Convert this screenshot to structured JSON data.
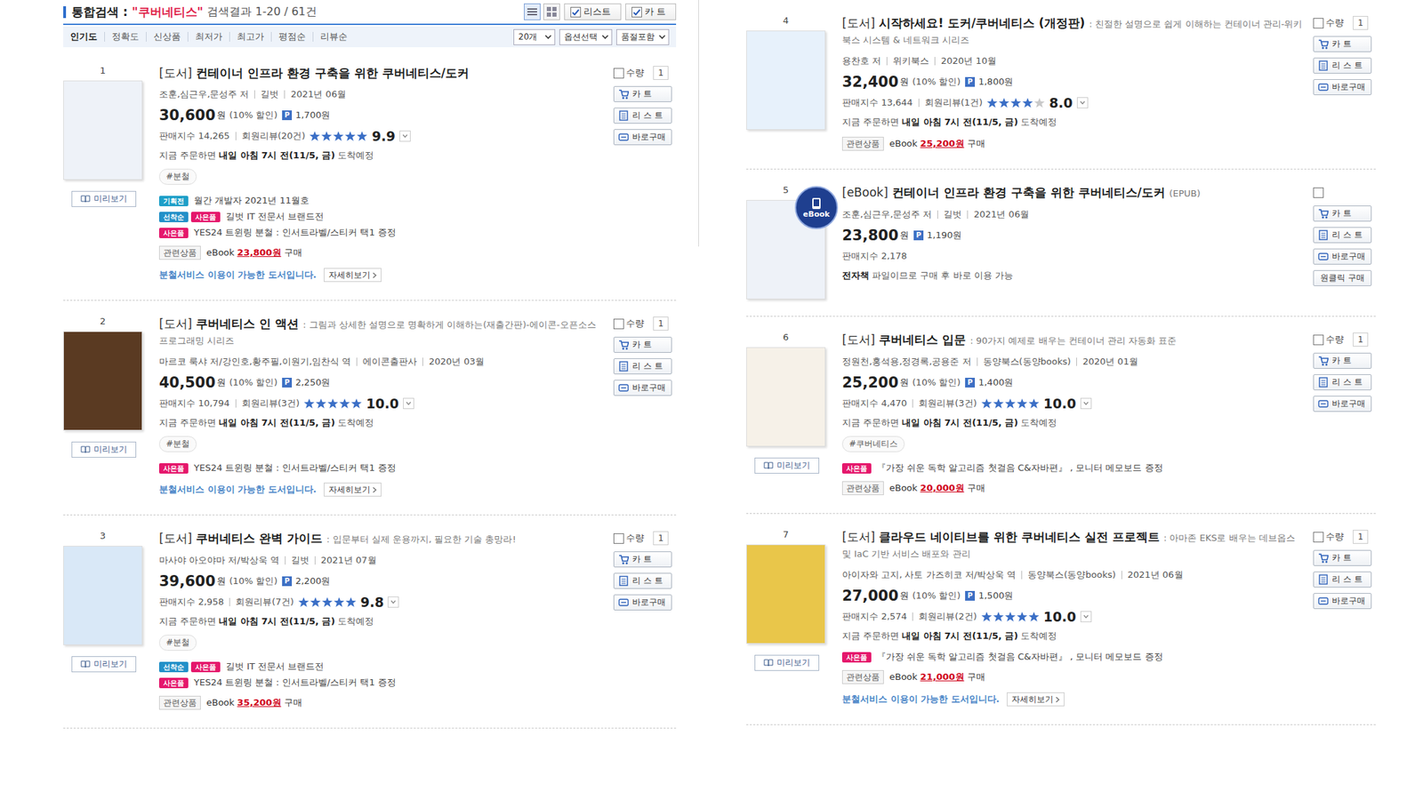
{
  "header": {
    "label": "통합검색 :",
    "query": "\"쿠버네티스\"",
    "result": "검색결과 1-20 / 61건"
  },
  "view_modes": [
    {
      "selected": true
    },
    {
      "selected": false
    }
  ],
  "view_actions": [
    {
      "label": "리스트",
      "checked": true
    },
    {
      "label": "카 트",
      "checked": true
    }
  ],
  "sort_tabs": [
    {
      "label": "인기도",
      "selected": true
    },
    {
      "label": "정확도",
      "selected": false
    },
    {
      "label": "신상품",
      "selected": false
    },
    {
      "label": "최저가",
      "selected": false
    },
    {
      "label": "최고가",
      "selected": false
    },
    {
      "label": "평점순",
      "selected": false
    },
    {
      "label": "리뷰순",
      "selected": false
    }
  ],
  "dropdowns": [
    "20개",
    "옵션선택",
    "품절포함"
  ],
  "items": [
    {
      "rank": "1",
      "column": "left",
      "checked": false,
      "qty_label": "수량",
      "qty": "1",
      "buttons": [
        {
          "label": "카 트",
          "kind": "cart"
        },
        {
          "label": "리 스 트",
          "kind": "list"
        },
        {
          "label": "바로구매",
          "kind": "buy"
        }
      ],
      "cover": "#eef2f8",
      "preview": "미리보기",
      "cat": "[도서]",
      "title": "컨테이너 인프라 환경 구축을 위한 쿠버네티스/도커",
      "authors": "조훈,심근우,문성주 저",
      "publisher": "길벗",
      "date": "2021년 06월",
      "price": "30,600",
      "won": "원",
      "discount": "(10% 할인)",
      "point_badge": "P",
      "points": "1,700원",
      "sales": "판매지수 14,265",
      "reviews": "회원리뷰(20건)",
      "stars": 5,
      "rating": "9.9",
      "delivery": {
        "pre": "지금 주문하면 ",
        "bold": "내일 아침 7시 전(11/5, 금)",
        "post": " 도착예정"
      },
      "hashtags": [
        "#분철"
      ],
      "promos": [
        {
          "badges": [
            {
              "label": "기획전",
              "color": "#1e9fc8"
            }
          ],
          "text": "월간 개발자 2021년 11월호"
        },
        {
          "badges": [
            {
              "label": "선착순",
              "color": "#2390c8"
            },
            {
              "label": "사은품",
              "color": "#e5186c"
            }
          ],
          "text": "길벗 IT 전문서 브랜드전"
        },
        {
          "badges": [
            {
              "label": "사은품",
              "color": "#e5186c"
            }
          ],
          "text": "YES24 트윈링 분철 : 인서트라벨/스티커 택1 증정"
        }
      ],
      "related": {
        "label": "관련상품",
        "kind": "eBook",
        "price": "23,800원",
        "action": "구매"
      },
      "split": {
        "text": "분철서비스 이용이 가능한 도서입니다.",
        "button": "자세히보기"
      }
    },
    {
      "rank": "2",
      "column": "left",
      "checked": false,
      "qty_label": "수량",
      "qty": "1",
      "buttons": [
        {
          "label": "카 트",
          "kind": "cart"
        },
        {
          "label": "리 스 트",
          "kind": "list"
        },
        {
          "label": "바로구매",
          "kind": "buy"
        }
      ],
      "cover": "#5a3a22",
      "preview": "미리보기",
      "cat": "[도서]",
      "title": "쿠버네티스 인 액션",
      "subtitle": ": 그림과 상세한 설명으로 명확하게 이해하는(재출간판)-에이콘-오픈소스 프로그래밍 시리즈",
      "authors": "마르코 룩샤 저/강인호,황주필,이원기,임찬식 역",
      "publisher": "에이콘출판사",
      "date": "2020년 03월",
      "price": "40,500",
      "won": "원",
      "discount": "(10% 할인)",
      "point_badge": "P",
      "points": "2,250원",
      "sales": "판매지수 10,794",
      "reviews": "회원리뷰(3건)",
      "stars": 5,
      "rating": "10.0",
      "delivery": {
        "pre": "지금 주문하면 ",
        "bold": "내일 아침 7시 전(11/5, 금)",
        "post": " 도착예정"
      },
      "hashtags": [
        "#분철"
      ],
      "promos": [
        {
          "badges": [
            {
              "label": "사은품",
              "color": "#e5186c"
            }
          ],
          "text": "YES24 트윈링 분철 : 인서트라벨/스티커 택1 증정"
        }
      ],
      "split": {
        "text": "분철서비스 이용이 가능한 도서입니다.",
        "button": "자세히보기"
      }
    },
    {
      "rank": "3",
      "column": "left",
      "checked": false,
      "qty_label": "수량",
      "qty": "1",
      "buttons": [
        {
          "label": "카 트",
          "kind": "cart"
        },
        {
          "label": "리 스 트",
          "kind": "list"
        },
        {
          "label": "바로구매",
          "kind": "buy"
        }
      ],
      "cover": "#d9e8f7",
      "preview": "미리보기",
      "cat": "[도서]",
      "title": "쿠버네티스 완벽 가이드",
      "subtitle": ": 입문부터 실제 운용까지, 필요한 기술 총망라!",
      "authors": "마사야 아오야마 저/박상욱 역",
      "publisher": "길벗",
      "date": "2021년 07월",
      "price": "39,600",
      "won": "원",
      "discount": "(10% 할인)",
      "point_badge": "P",
      "points": "2,200원",
      "sales": "판매지수 2,958",
      "reviews": "회원리뷰(7건)",
      "stars": 5,
      "rating": "9.8",
      "delivery": {
        "pre": "지금 주문하면 ",
        "bold": "내일 아침 7시 전(11/5, 금)",
        "post": " 도착예정"
      },
      "hashtags": [
        "#분철"
      ],
      "promos": [
        {
          "badges": [
            {
              "label": "선착순",
              "color": "#2390c8"
            },
            {
              "label": "사은품",
              "color": "#e5186c"
            }
          ],
          "text": "길벗 IT 전문서 브랜드전"
        },
        {
          "badges": [
            {
              "label": "사은품",
              "color": "#e5186c"
            }
          ],
          "text": "YES24 트윈링 분철 : 인서트라벨/스티커 택1 증정"
        }
      ],
      "related": {
        "label": "관련상품",
        "kind": "eBook",
        "price": "35,200원",
        "action": "구매"
      }
    },
    {
      "rank": "4",
      "column": "right",
      "checked": false,
      "qty_label": "수량",
      "qty": "1",
      "buttons": [
        {
          "label": "카 트",
          "kind": "cart"
        },
        {
          "label": "리 스 트",
          "kind": "list"
        },
        {
          "label": "바로구매",
          "kind": "buy"
        }
      ],
      "cover": "#e7f1fb",
      "cat": "[도서]",
      "title": "시작하세요! 도커/쿠버네티스 (개정판)",
      "subtitle": ": 친절한 설명으로 쉽게 이해하는 컨테이너 관리-위키북스 시스템 & 네트워크 시리즈",
      "authors": "용찬호 저",
      "publisher": "위키북스",
      "date": "2020년 10월",
      "price": "32,400",
      "won": "원",
      "discount": "(10% 할인)",
      "point_badge": "P",
      "points": "1,800원",
      "sales": "판매지수 13,644",
      "reviews": "회원리뷰(1건)",
      "stars": 4,
      "rating": "8.0",
      "delivery": {
        "pre": "지금 주문하면 ",
        "bold": "내일 아침 7시 전(11/5, 금)",
        "post": " 도착예정"
      },
      "hashtags": [],
      "promos": [],
      "related": {
        "label": "관련상품",
        "kind": "eBook",
        "price": "25,200원",
        "action": "구매"
      }
    },
    {
      "rank": "5",
      "column": "right",
      "checked": false,
      "buttons": [
        {
          "label": "카 트",
          "kind": "cart"
        },
        {
          "label": "리 스 트",
          "kind": "list"
        },
        {
          "label": "바로구매",
          "kind": "buy"
        },
        {
          "label": "원클릭 구매",
          "kind": "oneclick"
        }
      ],
      "cover": "#eef2f8",
      "thumb_badge": "eBook",
      "cat": "[eBook]",
      "title": "컨테이너 인프라 환경 구축을 위한 쿠버네티스/도커",
      "subtitle": "(EPUB)",
      "authors": "조훈,심근우,문성주 저",
      "publisher": "길벗",
      "date": "2021년 06월",
      "price": "23,800",
      "won": "원",
      "point_badge": "P",
      "points": "1,190원",
      "sales": "판매지수 2,178",
      "ebook_note": {
        "bold": "전자책",
        "rest": " 파일이므로 구매 후 바로 이용 가능"
      },
      "hashtags": [],
      "promos": []
    },
    {
      "rank": "6",
      "column": "right",
      "checked": false,
      "qty_label": "수량",
      "qty": "1",
      "buttons": [
        {
          "label": "카 트",
          "kind": "cart"
        },
        {
          "label": "리 스 트",
          "kind": "list"
        },
        {
          "label": "바로구매",
          "kind": "buy"
        }
      ],
      "cover": "#f6f1e8",
      "preview": "미리보기",
      "cat": "[도서]",
      "title": "쿠버네티스 입문",
      "subtitle": ": 90가지 예제로 배우는 컨테이너 관리 자동화 표준",
      "authors": "정원천,홍석용,정경록,공용준 저",
      "publisher": "동양북스(동양books)",
      "date": "2020년 01월",
      "price": "25,200",
      "won": "원",
      "discount": "(10% 할인)",
      "point_badge": "P",
      "points": "1,400원",
      "sales": "판매지수 4,470",
      "reviews": "회원리뷰(3건)",
      "stars": 5,
      "rating": "10.0",
      "delivery": {
        "pre": "지금 주문하면 ",
        "bold": "내일 아침 7시 전(11/5, 금)",
        "post": " 도착예정"
      },
      "hashtags": [
        "#쿠버네티스"
      ],
      "promos": [
        {
          "badges": [
            {
              "label": "사은품",
              "color": "#e5186c"
            }
          ],
          "text": "『가장 쉬운 독학 알고리즘 첫걸음 C&자바편』 , 모니터 메모보드 증정"
        }
      ],
      "related": {
        "label": "관련상품",
        "kind": "eBook",
        "price": "20,000원",
        "action": "구매"
      }
    },
    {
      "rank": "7",
      "column": "right",
      "checked": false,
      "qty_label": "수량",
      "qty": "1",
      "buttons": [
        {
          "label": "카 트",
          "kind": "cart"
        },
        {
          "label": "리 스 트",
          "kind": "list"
        },
        {
          "label": "바로구매",
          "kind": "buy"
        }
      ],
      "cover": "#e9c64a",
      "preview": "미리보기",
      "cat": "[도서]",
      "title": "클라우드 네이티브를 위한 쿠버네티스 실전 프로젝트",
      "subtitle": ": 아마존 EKS로 배우는 데브옵스 및 IaC 기반 서비스 배포와 관리",
      "authors": "아이자와 고지, 사토 가즈히코 저/박상욱 역",
      "publisher": "동양북스(동양books)",
      "date": "2021년 06월",
      "price": "27,000",
      "won": "원",
      "discount": "(10% 할인)",
      "point_badge": "P",
      "points": "1,500원",
      "sales": "판매지수 2,574",
      "reviews": "회원리뷰(2건)",
      "stars": 5,
      "rating": "10.0",
      "delivery": {
        "pre": "지금 주문하면 ",
        "bold": "내일 아침 7시 전(11/5, 금)",
        "post": " 도착예정"
      },
      "hashtags": [],
      "promos": [
        {
          "badges": [
            {
              "label": "사은품",
              "color": "#e5186c"
            }
          ],
          "text": "『가장 쉬운 독학 알고리즘 첫걸음 C&자바편』 , 모니터 메모보드 증정"
        }
      ],
      "related": {
        "label": "관련상품",
        "kind": "eBook",
        "price": "21,000원",
        "action": "구매"
      },
      "split": {
        "text": "분철서비스 이용이 가능한 도서입니다.",
        "button": "자세히보기"
      }
    }
  ]
}
